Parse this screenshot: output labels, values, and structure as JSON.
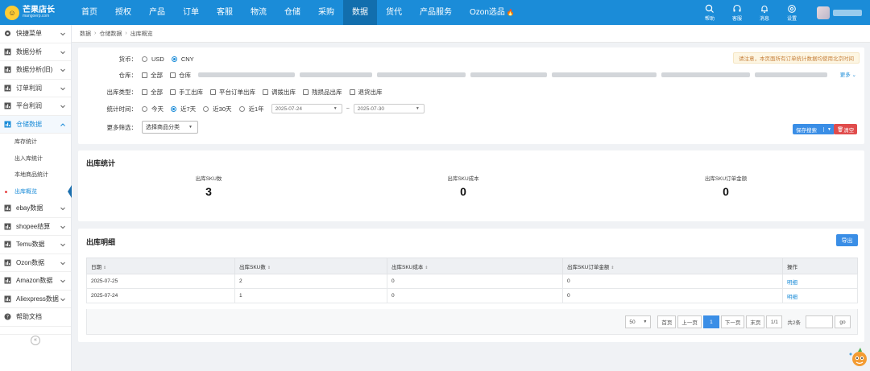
{
  "brand": {
    "name": "芒果店长",
    "domain": "mangoerp.com"
  },
  "nav": [
    {
      "label": "首页"
    },
    {
      "label": "授权"
    },
    {
      "label": "产品"
    },
    {
      "label": "订单"
    },
    {
      "label": "客服"
    },
    {
      "label": "物流"
    },
    {
      "label": "仓储"
    },
    {
      "label": "采购"
    },
    {
      "label": "数据",
      "active": true
    },
    {
      "label": "货代"
    },
    {
      "label": "产品服务"
    },
    {
      "label": "Ozon选品"
    }
  ],
  "top_icons": {
    "help": "帮助",
    "service": "客服",
    "message": "消息",
    "settings": "设置"
  },
  "sidebar": {
    "items": [
      {
        "label": "快捷菜单",
        "icon": "gear-icon"
      },
      {
        "label": "数据分析",
        "icon": "chart-icon"
      },
      {
        "label": "数据分析(旧)",
        "icon": "chart-icon"
      },
      {
        "label": "订单利润",
        "icon": "chart-icon"
      },
      {
        "label": "平台利润",
        "icon": "chart-icon"
      },
      {
        "label": "仓储数据",
        "icon": "chart-icon",
        "open": true
      },
      {
        "label": "ebay数据",
        "icon": "chart-icon"
      },
      {
        "label": "shopee结算",
        "icon": "chart-icon"
      },
      {
        "label": "Temu数据",
        "icon": "chart-icon"
      },
      {
        "label": "Ozon数据",
        "icon": "chart-icon"
      },
      {
        "label": "Amazon数据",
        "icon": "chart-icon"
      },
      {
        "label": "Aliexpress数据",
        "icon": "chart-icon"
      },
      {
        "label": "帮助文档",
        "icon": "help-icon"
      }
    ],
    "subitems": [
      {
        "label": "库存统计"
      },
      {
        "label": "出入库统计"
      },
      {
        "label": "本地商品统计"
      },
      {
        "label": "出库概览",
        "active": true
      }
    ],
    "collapse_label": "«"
  },
  "breadcrumb": [
    "数据",
    "仓储数据",
    "出库概览"
  ],
  "filter": {
    "notice": "请注意，本页面所有订单统计数据均使用北京时间",
    "more": "更多",
    "currency_label": "货币：",
    "currency_options": [
      "USD",
      "CNY"
    ],
    "currency_selected": "CNY",
    "warehouse_label": "仓库：",
    "warehouse_all": "全部",
    "warehouse_first": "仓库",
    "type_label": "出库类型：",
    "type_options": [
      "全部",
      "手工出库",
      "平台订单出库",
      "调拨出库",
      "残损品出库",
      "退货出库"
    ],
    "time_label": "统计时间：",
    "time_options": [
      "今天",
      "近7天",
      "近30天",
      "近1年"
    ],
    "time_selected": "近7天",
    "date_from": "2025-07-24",
    "date_sep": "~",
    "date_to": "2025-07-30",
    "more_filter_label": "更多筛选：",
    "category_placeholder": "选择商品分类",
    "save_search": "保存搜索",
    "clear": "清空"
  },
  "stats": {
    "title": "出库统计",
    "items": [
      {
        "label": "出库SKU数",
        "value": "3"
      },
      {
        "label": "出库SKU成本",
        "value": "0"
      },
      {
        "label": "出库SKU订单金额",
        "value": "0"
      }
    ]
  },
  "detail": {
    "title": "出库明细",
    "export": "导出",
    "columns": [
      "日期",
      "出库SKU数",
      "出库SKU成本",
      "出库SKU订单金额",
      "操作"
    ],
    "rows": [
      {
        "date": "2025-07-25",
        "sku_count": "2",
        "cost": "0",
        "amount": "0",
        "action": "明细"
      },
      {
        "date": "2025-07-24",
        "sku_count": "1",
        "cost": "0",
        "amount": "0",
        "action": "明细"
      }
    ],
    "pager": {
      "page_size": "50",
      "first": "首页",
      "prev": "上一页",
      "current": "1",
      "next": "下一页",
      "last": "末页",
      "page_info": "1/1",
      "total": "共2条",
      "go": "go"
    }
  },
  "colors": {
    "primary": "#1b8cd8",
    "topbar": "#1b8cd8",
    "danger": "#e04c4c",
    "notice_text": "#c6803b"
  }
}
